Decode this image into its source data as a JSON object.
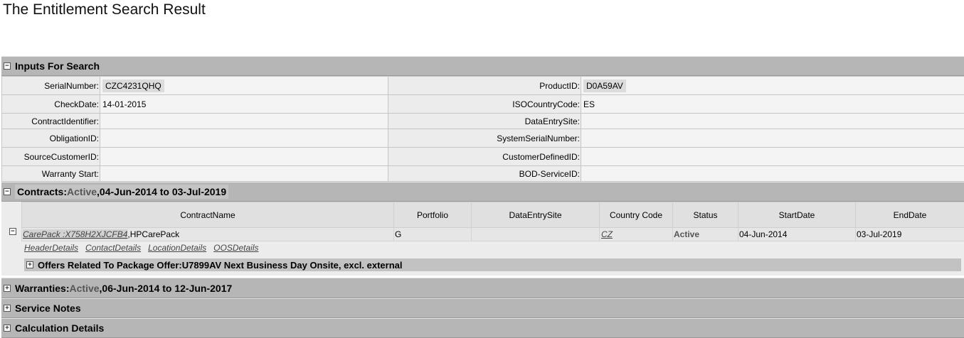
{
  "page_title": "The Entitlement Search Result",
  "inputs": {
    "title": "Inputs For Search",
    "rows": [
      {
        "left_label": "SerialNumber:",
        "left_value": "CZC4231QHQ",
        "right_label": "ProductID:",
        "right_value": "D0A59AV"
      },
      {
        "left_label": "CheckDate:",
        "left_value": "14-01-2015",
        "right_label": "ISOCountryCode:",
        "right_value": "ES"
      },
      {
        "left_label": "ContractIdentifier:",
        "left_value": "",
        "right_label": "DataEntrySite:",
        "right_value": ""
      },
      {
        "left_label": "ObligationID:",
        "left_value": "",
        "right_label": "SystemSerialNumber:",
        "right_value": ""
      },
      {
        "left_label": "SourceCustomerID:",
        "left_value": "",
        "right_label": "CustomerDefinedID:",
        "right_value": ""
      },
      {
        "left_label": "Warranty Start:",
        "left_value": "",
        "right_label": "BOD-ServiceID:",
        "right_value": ""
      }
    ]
  },
  "contracts": {
    "prefix": "Contracts:",
    "status": "Active",
    "range": ",04-Jun-2014 to 03-Jul-2019",
    "columns": [
      "ContractName",
      "Portfolio",
      "DataEntrySite",
      "Country Code",
      "Status",
      "StartDate",
      "EndDate"
    ],
    "row": {
      "contract_link": "CarePack :X758H2XJCFB4",
      "contract_suffix": ",HPCarePack",
      "portfolio": "G",
      "data_entry_site": "",
      "country_code": "CZ",
      "status": "Active",
      "start_date": "04-Jun-2014",
      "end_date": "03-Jul-2019"
    },
    "detail_links": [
      "HeaderDetails",
      "ContactDetails",
      "LocationDetails",
      "OOSDetails"
    ],
    "offers_label": "Offers Related To Package Offer:U7899AV Next Business Day Onsite, excl. external"
  },
  "warranties": {
    "prefix": "Warranties:",
    "status": "Active",
    "range": ",06-Jun-2014 to 12-Jun-2017"
  },
  "service_notes": {
    "title": "Service Notes"
  },
  "calculation_details": {
    "title": "Calculation Details"
  },
  "toggle_symbols": {
    "expanded": "−",
    "collapsed": "+"
  }
}
